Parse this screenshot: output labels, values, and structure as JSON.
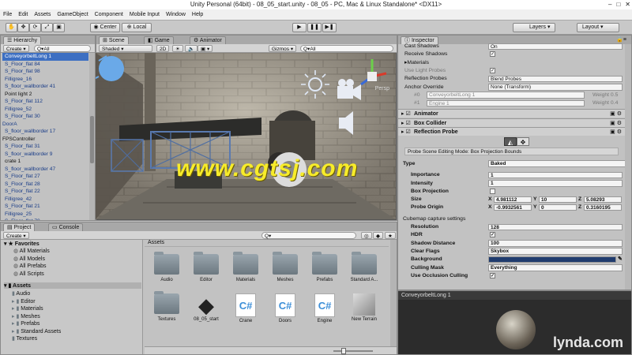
{
  "window": {
    "title": "Unity Personal (64bit) - 08_05_start.unity - 08_05 - PC, Mac & Linux Standalone* <DX11>",
    "controls": [
      "–",
      "□",
      "✕"
    ]
  },
  "menu": [
    "File",
    "Edit",
    "Assets",
    "GameObject",
    "Component",
    "Mobile Input",
    "Window",
    "Help"
  ],
  "toolbar": {
    "pivot": "Center",
    "space": "Local",
    "layers": "Layers",
    "layout": "Layout",
    "tools": [
      "hand-icon",
      "move-icon",
      "rotate-icon",
      "scale-icon",
      "rect-icon"
    ]
  },
  "hierarchy": {
    "tab": "Hierarchy",
    "create": "Create",
    "search": "Q▾All",
    "items": [
      "ConveyorbeltLong 1",
      "S_Floor_flat 84",
      "S_Floor_flat 98",
      "Filligree_16",
      "S_floor_wallborder 41",
      "Point light 2",
      "S_Floor_flat 112",
      "Filligree_52",
      "S_Floor_flat 30",
      "DoorA",
      "S_floor_wallborder 17",
      "FPSController",
      "S_Floor_flat 31",
      "S_floor_wallborder 9",
      "crate 1",
      "S_floor_wallborder 47",
      "S_Floor_flat 27",
      "S_Floor_flat 28",
      "S_Floor_flat 22",
      "Filligree_42",
      "S_Floor_flat 21",
      "Filligree_25",
      "S_Floor_flat 70"
    ]
  },
  "scene": {
    "tabs": [
      "Scene",
      "Game",
      "Animator"
    ],
    "shading": "Shaded",
    "mode": "2D",
    "gizmos": "Gizmos ▾",
    "search": "Q▾All",
    "persp": "Persp",
    "watermark": "www.cgtsj.com"
  },
  "project": {
    "tabs": [
      "Project",
      "Console"
    ],
    "create": "Create",
    "favorites_label": "Favorites",
    "favorites": [
      "All Materials",
      "All Models",
      "All Prefabs",
      "All Scripts"
    ],
    "assets_label": "Assets",
    "tree": [
      "Audio",
      "Editor",
      "Materials",
      "Meshes",
      "Prefabs",
      "Standard Assets",
      "Textures"
    ],
    "breadcrumb": "Assets",
    "grid": [
      {
        "label": "Audio",
        "kind": "folder"
      },
      {
        "label": "Editor",
        "kind": "folder"
      },
      {
        "label": "Materials",
        "kind": "folder"
      },
      {
        "label": "Meshes",
        "kind": "folder"
      },
      {
        "label": "Prefabs",
        "kind": "folder"
      },
      {
        "label": "Standard A...",
        "kind": "folder"
      },
      {
        "label": "Textures",
        "kind": "folder"
      },
      {
        "label": "08_05_start",
        "kind": "unity"
      },
      {
        "label": "Crane",
        "kind": "cs"
      },
      {
        "label": "Doors",
        "kind": "cs"
      },
      {
        "label": "Engine",
        "kind": "cs"
      },
      {
        "label": "New Terrain",
        "kind": "terrain"
      }
    ]
  },
  "inspector": {
    "tab": "Inspector",
    "top_rows": [
      {
        "label": "Cast Shadows",
        "value": "On"
      },
      {
        "label": "Receive Shadows",
        "check": "✓"
      },
      {
        "label": "▸Materials"
      },
      {
        "label": "Use Light Probes",
        "check": "✓"
      },
      {
        "label": "Reflection Probes",
        "value": "Blend Probes"
      },
      {
        "label": "Anchor Override",
        "value": "None (Transform)"
      }
    ],
    "probes": [
      {
        "idx": "#0",
        "name": "ConveyorbeltLong 1",
        "weight": "Weight 0.5"
      },
      {
        "idx": "#1",
        "name": "Engine 1",
        "weight": "Weight 0.4"
      }
    ],
    "components": [
      "Animator",
      "Box Collider",
      "Reflection Probe"
    ],
    "editing_mode": "Probe Scene Editing Mode: Box Projection Bounds",
    "type": {
      "label": "Type",
      "value": "Baked"
    },
    "importance": {
      "label": "Importance",
      "value": "1"
    },
    "intensity": {
      "label": "Intensity",
      "value": "1"
    },
    "box_projection": {
      "label": "Box Projection"
    },
    "size": {
      "label": "Size",
      "x": "4.981112",
      "y": "10",
      "z": "5.08293"
    },
    "origin": {
      "label": "Probe Origin",
      "x": "-0.9932561",
      "y": "0",
      "z": "0.3160195"
    },
    "cubemap_header": "Cubemap capture settings",
    "resolution": {
      "label": "Resolution",
      "value": "128"
    },
    "hdr": {
      "label": "HDR",
      "check": "✓"
    },
    "shadow_distance": {
      "label": "Shadow Distance",
      "value": "100"
    },
    "clear_flags": {
      "label": "Clear Flags",
      "value": "Skybox"
    },
    "background": {
      "label": "Background",
      "color": "#1f3b6e"
    },
    "culling_mask": {
      "label": "Culling Mask",
      "value": "Everything"
    },
    "occlusion": {
      "label": "Use Occlusion Culling",
      "check": "✓"
    },
    "preview_title": "ConveyorbeltLong 1",
    "logo": "lynda.com"
  }
}
